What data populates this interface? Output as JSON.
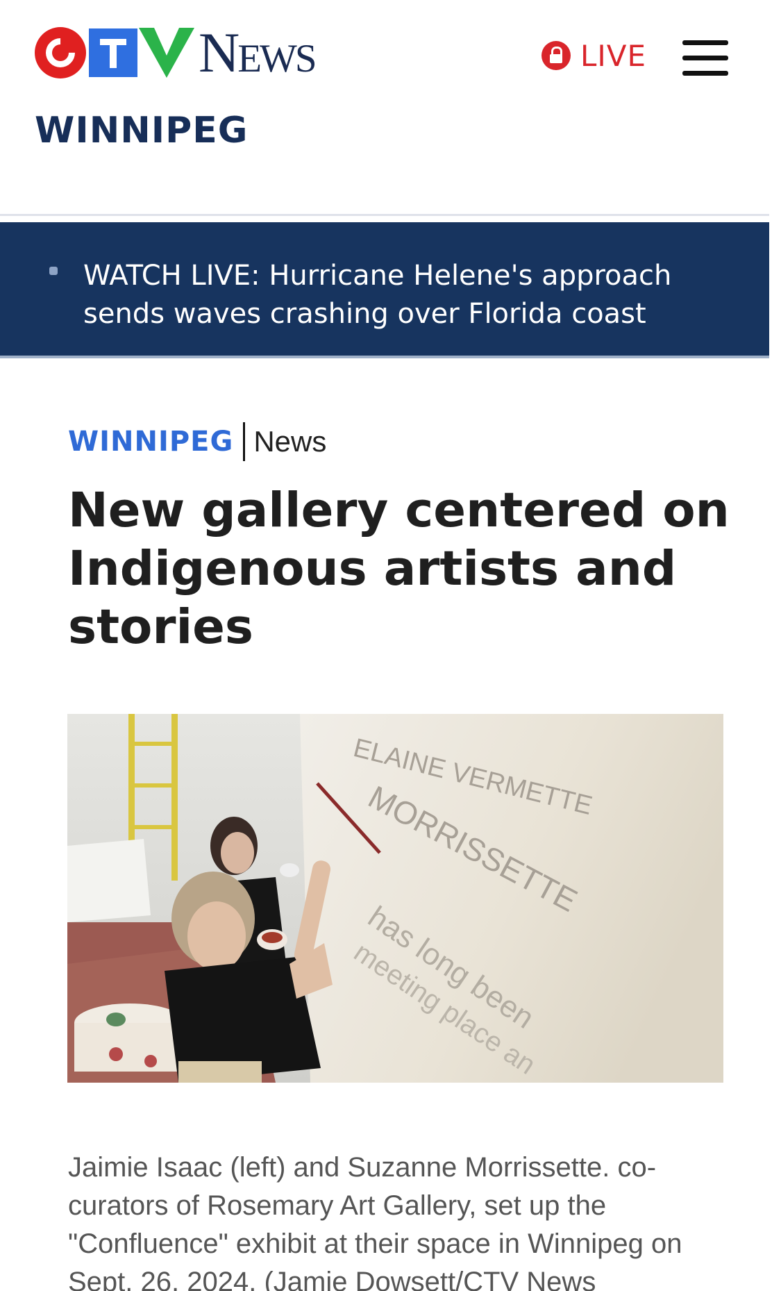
{
  "brand": {
    "logo_word": "News",
    "logo_alt": "CTV News",
    "region": "WINNIPEG"
  },
  "header": {
    "live_label": "LIVE",
    "menu_icon": "hamburger-menu-icon"
  },
  "breaking": {
    "text": "WATCH LIVE: Hurricane Helene's approach sends waves crashing over Florida coast"
  },
  "article": {
    "kicker_region": "WINNIPEG",
    "kicker_section": "News",
    "headline": "New gallery centered on Indigenous artists and stories",
    "image_alt": "Two women painting text onto a gallery wall",
    "wall_text": [
      "MORRISSETTE",
      "has long been",
      "meeting place an"
    ],
    "caption": "Jaimie Isaac (left) and Suzanne Morrissette. co-curators of Rosemary Art Gallery, set up the \"Confluence\" exhibit at their space in Winnipeg on Sept. 26, 2024. (Jamie Dowsett/CTV News"
  },
  "colors": {
    "brand_navy": "#172e58",
    "banner_bg": "#17345f",
    "kicker_blue": "#2f6ad6",
    "live_red": "#d9252b"
  }
}
